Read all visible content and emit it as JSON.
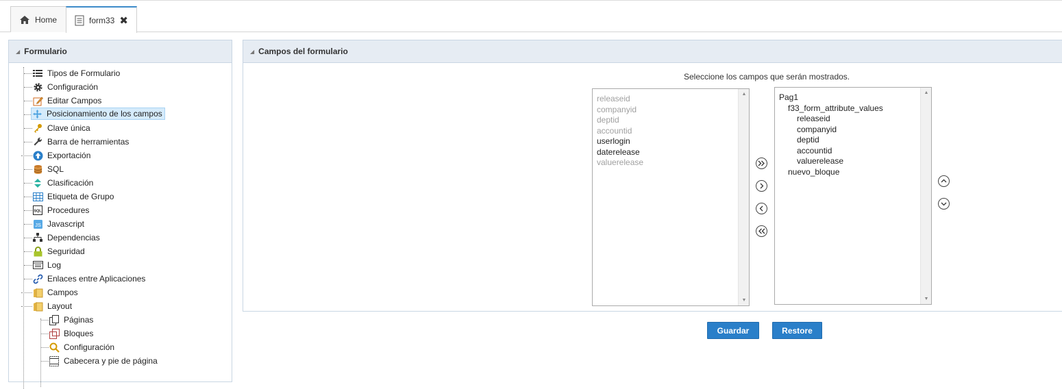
{
  "tabs": {
    "home_label": "Home",
    "form_label": "form33",
    "close_glyph": "✖"
  },
  "left_panel": {
    "title": "Formulario",
    "items": [
      {
        "label": "Tipos de Formulario",
        "icon": "list-icon"
      },
      {
        "label": "Configuración",
        "icon": "gear-icon"
      },
      {
        "label": "Editar Campos",
        "icon": "edit-icon"
      },
      {
        "label": "Posicionamiento de los campos",
        "icon": "move-icon",
        "selected": true
      },
      {
        "label": "Clave única",
        "icon": "key-icon"
      },
      {
        "label": "Barra de herramientas",
        "icon": "wrench-icon"
      },
      {
        "label": "Exportación",
        "icon": "export-icon"
      },
      {
        "label": "SQL",
        "icon": "database-icon"
      },
      {
        "label": "Clasificación",
        "icon": "sort-icon"
      },
      {
        "label": "Etiqueta de Grupo",
        "icon": "table-icon"
      },
      {
        "label": "Procedures",
        "icon": "sql-icon"
      },
      {
        "label": "Javascript",
        "icon": "js-icon"
      },
      {
        "label": "Dependencias",
        "icon": "hierarchy-icon"
      },
      {
        "label": "Seguridad",
        "icon": "lock-icon"
      },
      {
        "label": "Log",
        "icon": "log-icon"
      },
      {
        "label": "Enlaces entre Aplicaciones",
        "icon": "link-icon"
      },
      {
        "label": "Campos",
        "icon": "folder-icon"
      },
      {
        "label": "Layout",
        "icon": "folder-icon"
      }
    ],
    "layout_children": [
      {
        "label": "Páginas",
        "icon": "pages-icon"
      },
      {
        "label": "Bloques",
        "icon": "blocks-icon"
      },
      {
        "label": "Configuración",
        "icon": "magnifier-icon"
      },
      {
        "label": "Cabecera y pie de página",
        "icon": "header-footer-icon"
      }
    ]
  },
  "right_panel": {
    "title": "Campos del formulario",
    "instruction": "Seleccione los campos que serán mostrados.",
    "available_fields": [
      {
        "label": "releaseid",
        "disabled": true
      },
      {
        "label": "companyid",
        "disabled": true
      },
      {
        "label": "deptid",
        "disabled": true
      },
      {
        "label": "accountid",
        "disabled": true
      },
      {
        "label": "userlogin",
        "disabled": false
      },
      {
        "label": "daterelease",
        "disabled": false
      },
      {
        "label": "valuerelease",
        "disabled": true
      }
    ],
    "selected_fields": [
      {
        "label": "Pag1",
        "level": 0
      },
      {
        "label": "f33_form_attribute_values",
        "level": 1
      },
      {
        "label": "releaseid",
        "level": 2
      },
      {
        "label": "companyid",
        "level": 2
      },
      {
        "label": "deptid",
        "level": 2
      },
      {
        "label": "accountid",
        "level": 2
      },
      {
        "label": "valuerelease",
        "level": 2
      },
      {
        "label": "nuevo_bloque",
        "level": 1
      }
    ],
    "save_label": "Guardar",
    "restore_label": "Restore"
  },
  "colors": {
    "accent": "#2a7fc9",
    "panel_header": "#e6ecf3",
    "selection": "#d5ebfb",
    "dim_text": "#a0a0a0"
  }
}
